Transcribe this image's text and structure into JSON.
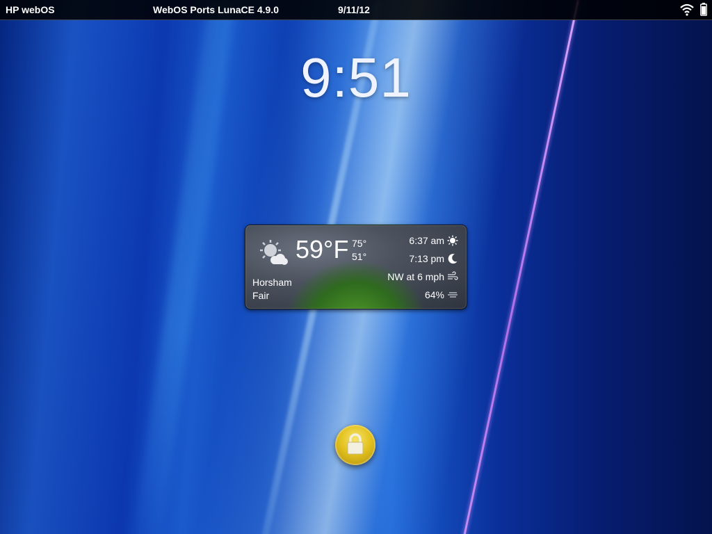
{
  "status_bar": {
    "carrier_title": "HP webOS",
    "app_title": "WebOS Ports LunaCE 4.9.0",
    "date": "9/11/12",
    "icons": [
      "wifi-icon",
      "battery-icon"
    ]
  },
  "clock": {
    "time": "9:51"
  },
  "weather": {
    "temperature": "59°F",
    "high": "75°",
    "low": "51°",
    "city": "Horsham",
    "condition": "Fair",
    "sunrise": "6:37 am",
    "sunset": "7:13 pm",
    "wind": "NW at 6 mph",
    "humidity": "64%",
    "icons": [
      "partly-cloudy-icon",
      "sun-icon",
      "moon-icon",
      "wind-icon",
      "humidity-icon"
    ]
  },
  "lock": {
    "icon": "lock-icon",
    "accent": "#e3c21f"
  },
  "colors": {
    "wallpaper_base": "#07237a",
    "streak_purple": "#c58cf0"
  }
}
